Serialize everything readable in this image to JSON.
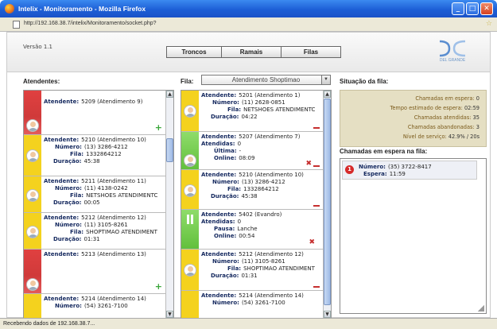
{
  "window": {
    "title": "Intelix - Monitoramento - Mozilla Firefox",
    "url": "http://192.168.38.7/intelix/Monitoramento/socket.php?"
  },
  "header": {
    "version": "Versão 1.1",
    "tabs": [
      "Troncos",
      "Ramais",
      "Filas"
    ],
    "logo_text": "DEL GRANDE"
  },
  "atendentes": {
    "title": "Atendentes:",
    "cards": [
      {
        "status": "red",
        "atendente": "5209 (Atendimento 9)",
        "action": "plus"
      },
      {
        "status": "yellow",
        "atendente": "5210 (Atendimento 10)",
        "numero": "(13) 3286-4212",
        "fila": "1332864212",
        "duracao": "45:38"
      },
      {
        "status": "yellow",
        "atendente": "5211 (Atendimento 11)",
        "numero": "(11) 4138-0242",
        "fila": "NETSHOES ATENDIMENTC",
        "duracao": "00:05"
      },
      {
        "status": "yellow",
        "atendente": "5212 (Atendimento 12)",
        "numero": "(11) 3105-8261",
        "fila": "SHOPTIMAO ATENDIMENT",
        "duracao": "01:31"
      },
      {
        "status": "red",
        "atendente": "5213 (Atendimento 13)",
        "action": "plus"
      },
      {
        "status": "yellow",
        "atendente": "5214 (Atendimento 14)",
        "numero": "(54) 3261-7100"
      }
    ]
  },
  "fila": {
    "label": "Fila:",
    "selected": "Atendimento Shoptimao",
    "cards": [
      {
        "status": "yellow",
        "atendente": "5201 (Atendimento 1)",
        "numero": "(11) 2628-0851",
        "fila": "NETSHOES ATENDIMENTC",
        "duracao": "04:22"
      },
      {
        "status": "green",
        "atendente": "5207 (Atendimento 7)",
        "atendidas": "0",
        "ultima": "-",
        "online": "08:09"
      },
      {
        "status": "yellow",
        "atendente": "5210 (Atendimento 10)",
        "numero": "(13) 3286-4212",
        "fila": "1332864212",
        "duracao": "45:38"
      },
      {
        "status": "green",
        "atendente": "5402 (Evandro)",
        "atendidas": "0",
        "pausa": "Lanche",
        "online": "00:54"
      },
      {
        "status": "yellow",
        "atendente": "5212 (Atendimento 12)",
        "numero": "(11) 3105-8261",
        "fila": "SHOPTIMAO ATENDIMENT",
        "duracao": "01:31"
      },
      {
        "status": "yellow",
        "atendente": "5214 (Atendimento 14)",
        "numero": "(54) 3261-7100"
      }
    ]
  },
  "labels": {
    "atendente": "Atendente:",
    "numero": "Número:",
    "fila": "Fila:",
    "duracao": "Duração:",
    "atendidas": "Atendidas:",
    "ultima": "Última:",
    "online": "Online:",
    "pausa": "Pausa:",
    "espera": "Espera:"
  },
  "situacao": {
    "title": "Situação da fila:",
    "rows": [
      {
        "label": "Chamadas em espera:",
        "value": "0"
      },
      {
        "label": "Tempo estimado de espera:",
        "value": "02:59"
      },
      {
        "label": "Chamadas atendidas:",
        "value": "35"
      },
      {
        "label": "Chamadas abandonadas:",
        "value": "3"
      },
      {
        "label": "Nível de serviço:",
        "value": "42.9% / 20s"
      }
    ]
  },
  "espera": {
    "title": "Chamadas em espera na fila:",
    "calls": [
      {
        "badge": "1",
        "numero": "(35) 3722-8417",
        "espera": "11:59"
      }
    ]
  },
  "statusbar": "Recebendo dados de 192.168.38.7..."
}
